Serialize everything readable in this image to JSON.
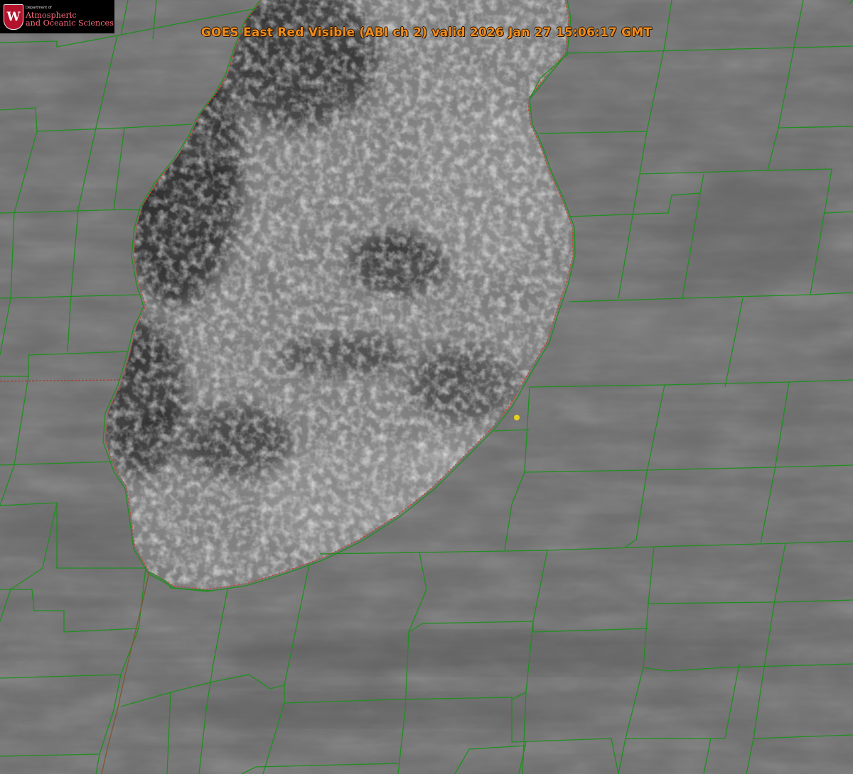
{
  "title": "GOES East Red Visible (ABI ch 2) valid 2026 Jan 27 15:06:17 GMT",
  "logo": {
    "department": "Department of",
    "line1": "Atmospheric",
    "line2": "and Oceanic Sciences",
    "seal_letter": "W"
  },
  "colors": {
    "border_green": "#1f8f1f",
    "shoreline_red": "#d04030",
    "lake_dark": "#2c2c2c",
    "land_gray": "#6e6e6e",
    "title_orange": "#f08c1c",
    "marker_yellow": "#e8d020",
    "logo_red": "#b4122c"
  },
  "map": {
    "type": "satellite-imagery",
    "channel": "ABI ch 2",
    "feature": "lake-effect cloud field over lake",
    "boundaries": "county lines",
    "marker": "yellow point"
  }
}
